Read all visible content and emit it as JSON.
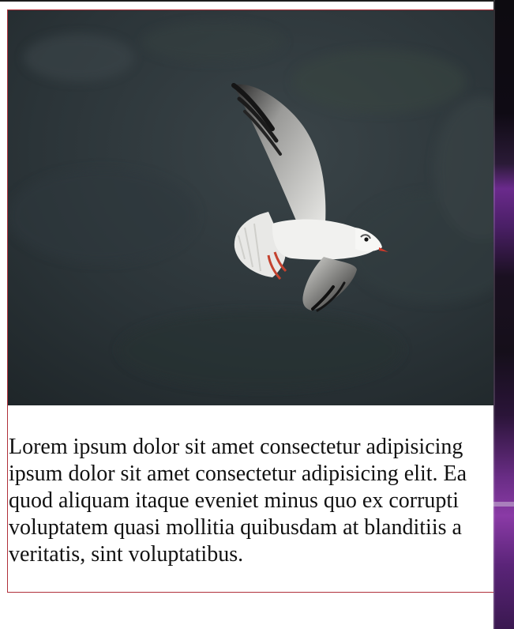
{
  "card": {
    "image_alt": "Seagull in flight over dark hillside",
    "paragraph_lines": [
      "Lorem ipsum dolor sit amet consectetur adipisicing",
      "ipsum dolor sit amet consectetur adipisicing elit. Ea",
      "quod aliquam itaque eveniet minus quo ex corrupti",
      "voluptatem quasi mollitia quibusdam at blanditiis a",
      "veritatis, sint voluptatibus."
    ]
  },
  "colors": {
    "card_border": "#b0303a",
    "photo_background": "#2a3236",
    "text": "#111111"
  }
}
